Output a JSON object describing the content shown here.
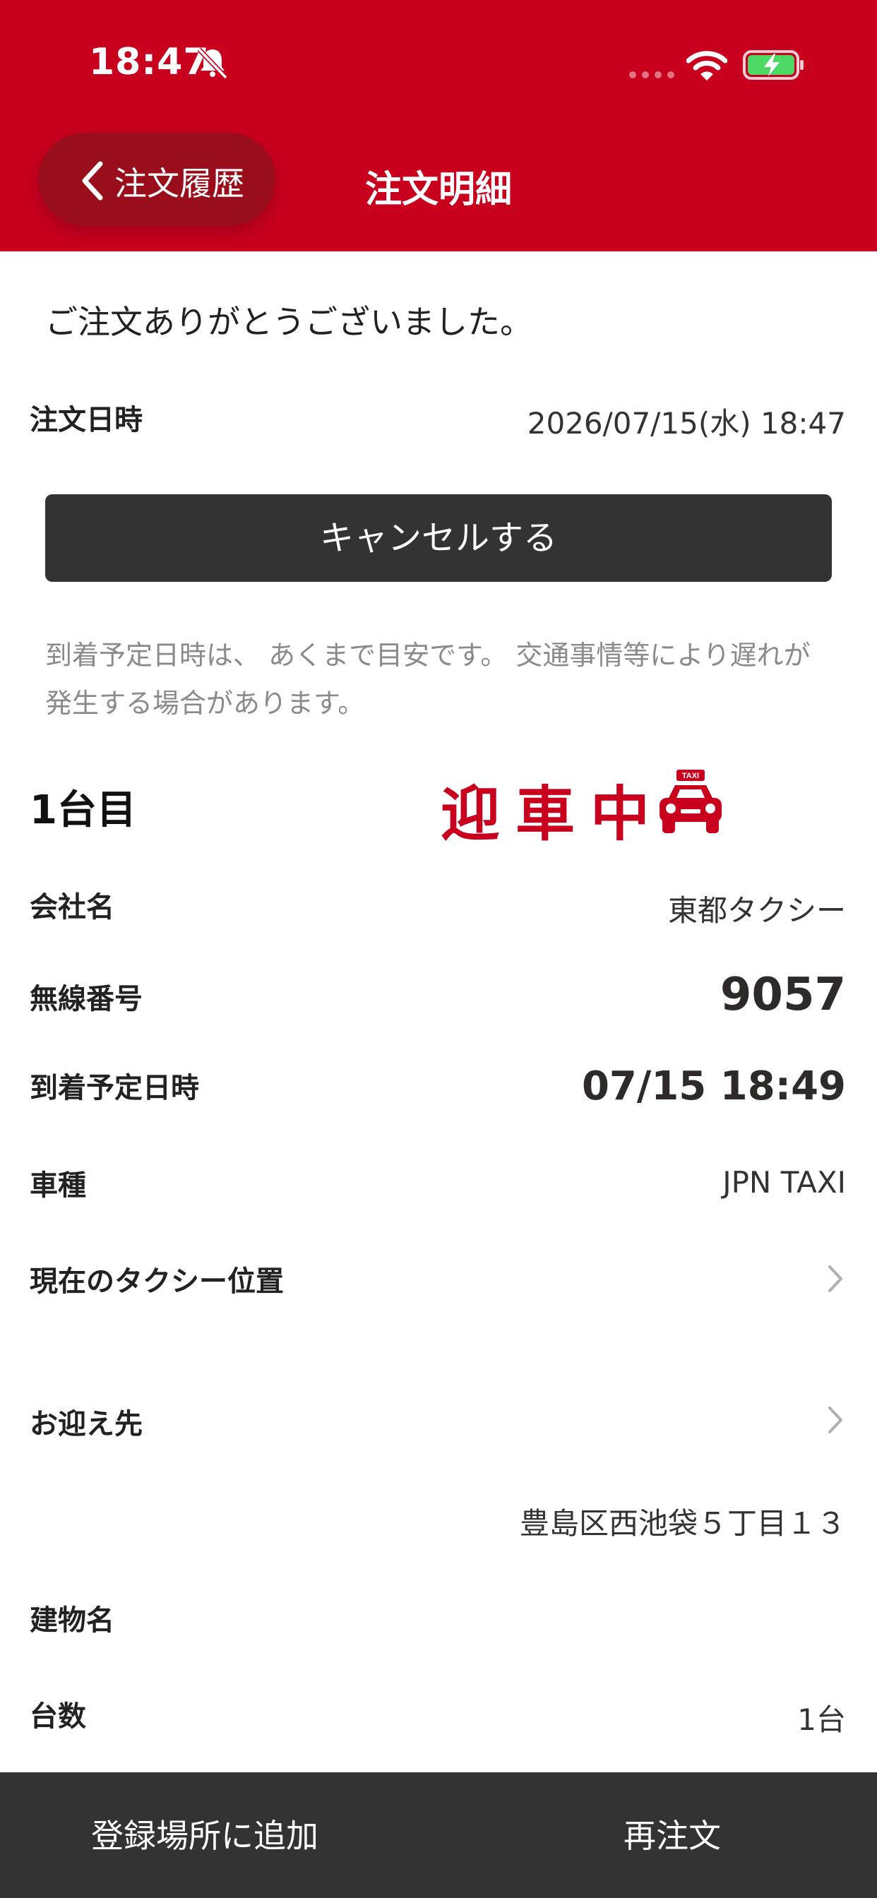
{
  "status_bar": {
    "time": "18:47"
  },
  "nav": {
    "back_label": "注文履歴",
    "title": "注文明細"
  },
  "thanks_message": "ご注文ありがとうございました。",
  "order_datetime": {
    "label": "注文日時",
    "value": "2026/07/15(水) 18:47"
  },
  "cancel_button": "キャンセルする",
  "notice": "到着予定日時は、 あくまで目安です。 交通事情等により遅れが発生する場合があります。",
  "vehicle": {
    "index_label": "1台目",
    "status": "迎車中",
    "taxi_sign": "TAXI",
    "company": {
      "label": "会社名",
      "value": "東都タクシー"
    },
    "radio_number": {
      "label": "無線番号",
      "value": "9057"
    },
    "eta": {
      "label": "到着予定日時",
      "value": "07/15 18:49"
    },
    "car_type": {
      "label": "車種",
      "value": "JPN TAXI"
    },
    "location_link": "現在のタクシー位置"
  },
  "pickup": {
    "label": "お迎え先",
    "address": "豊島区西池袋５丁目１３",
    "building_label": "建物名",
    "building_value": "",
    "count_label": "台数",
    "count_value": "1台"
  },
  "bottom": {
    "add_place": "登録場所に追加",
    "reorder": "再注文"
  },
  "colors": {
    "brand_red": "#c8001e",
    "dark": "#333333"
  }
}
